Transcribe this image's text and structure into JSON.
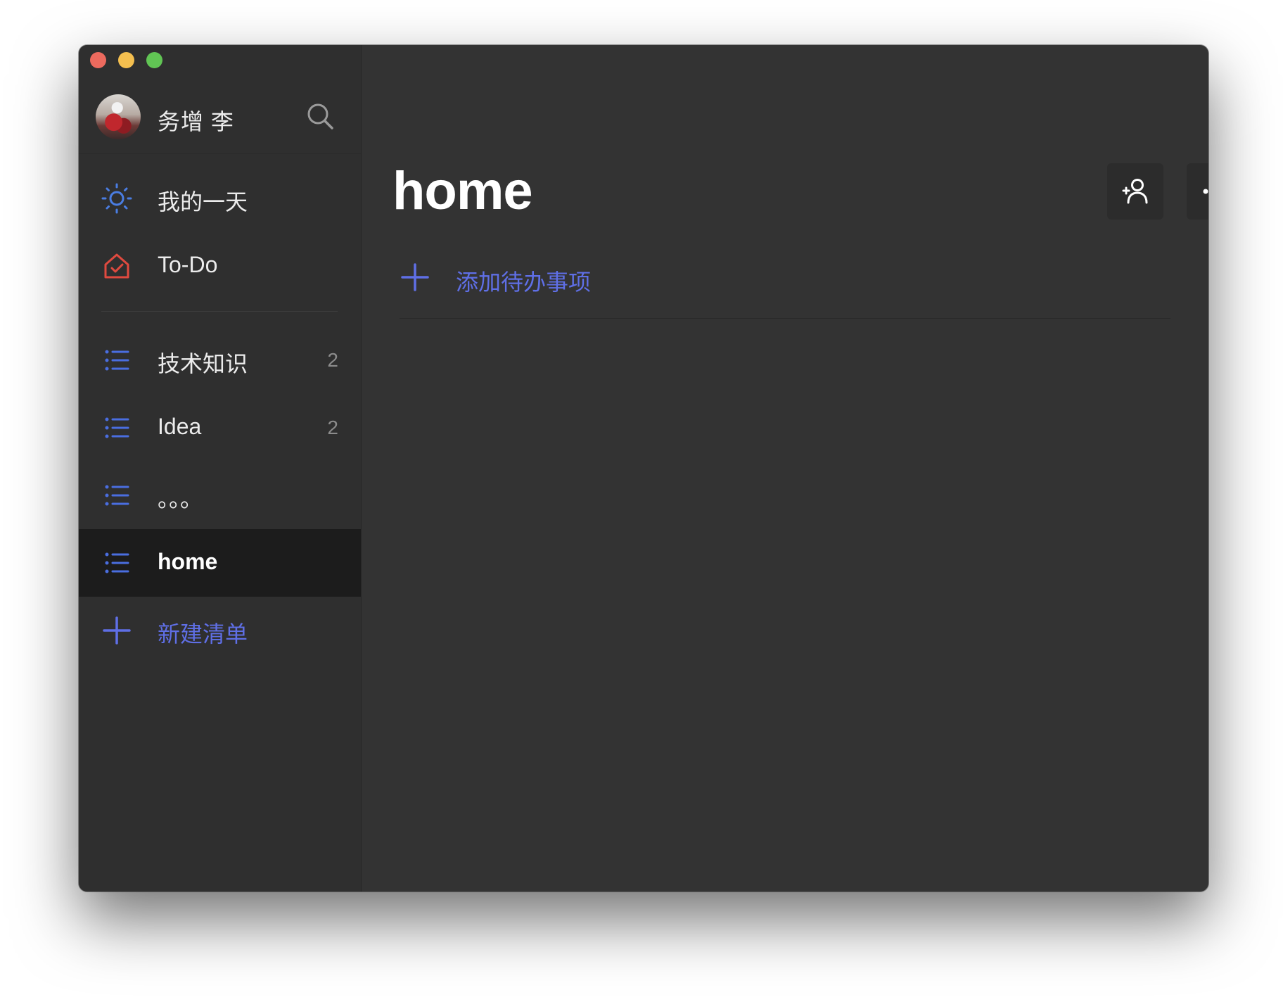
{
  "window": {
    "traffic_lights": [
      "#ec6a5e",
      "#f4bf4f",
      "#61c554"
    ]
  },
  "profile": {
    "name": "务增 李",
    "avatar": "avatar",
    "search_icon": "search-icon"
  },
  "sidebar": {
    "smart_lists": [
      {
        "label": "我的一天",
        "icon": "sun-icon",
        "color": "#4a7de2"
      },
      {
        "label": "To-Do",
        "icon": "house-check-icon",
        "color": "#e04a3f"
      }
    ],
    "lists": [
      {
        "label": "技术知识",
        "count": "2",
        "icon": "list-icon"
      },
      {
        "label": "Idea",
        "count": "2",
        "icon": "list-icon"
      },
      {
        "label": "。。。",
        "count": "",
        "icon": "list-icon"
      },
      {
        "label": "home",
        "count": "",
        "icon": "list-icon",
        "selected": true
      }
    ],
    "new_list_label": "新建清单"
  },
  "main": {
    "title": "home",
    "add_task_label": "添加待办事项",
    "share_icon": "add-person-icon",
    "more_icon": "more-icon"
  },
  "colors": {
    "accent": "#5f6fe6",
    "list_icon": "#4a6ee0",
    "sidebar_bg": "#2f2f2f",
    "main_bg": "#333333",
    "selected_bg": "#1c1c1c"
  }
}
